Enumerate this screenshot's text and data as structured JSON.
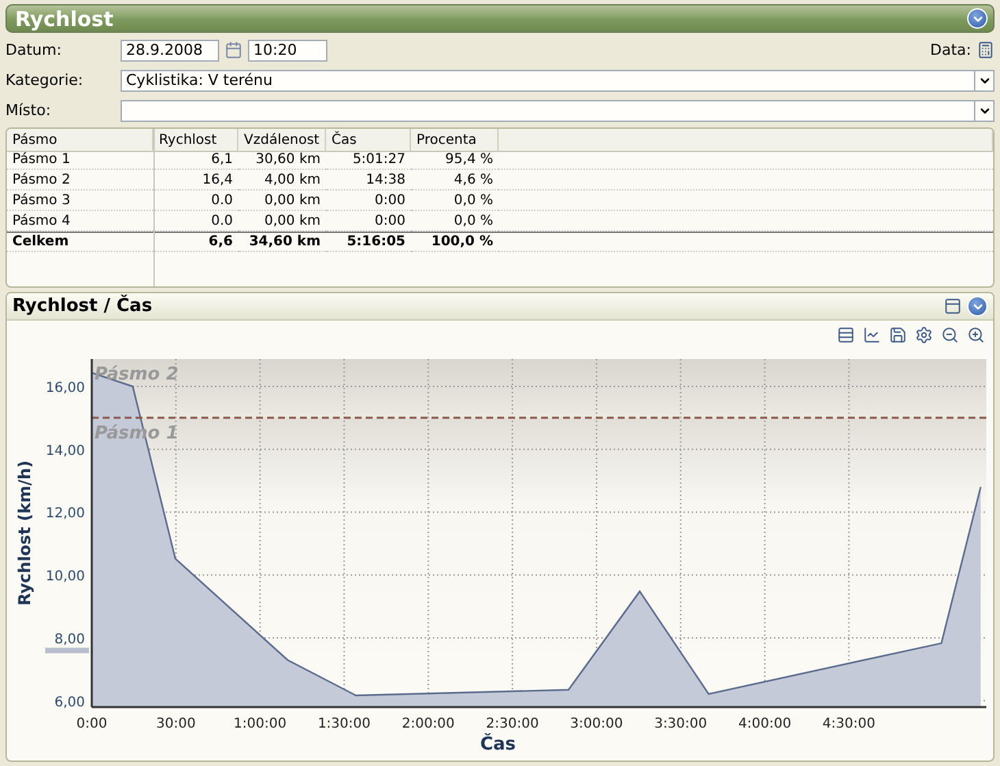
{
  "title": "Rychlost",
  "form": {
    "date_label": "Datum:",
    "date": "28.9.2008",
    "time": "10:20",
    "data_label": "Data:",
    "category_label": "Kategorie:",
    "category": "Cyklistika: V terénu",
    "place_label": "Místo:"
  },
  "table": {
    "columns": [
      "Pásmo",
      "Rychlost",
      "Vzdálenost",
      "Čas",
      "Procenta"
    ],
    "rows": [
      {
        "kind": "row",
        "cells": [
          "Pásmo 1",
          "6,1",
          "30,60 km",
          "5:01:27",
          "95,4 %"
        ]
      },
      {
        "kind": "row",
        "cells": [
          "Pásmo 2",
          "16,4",
          "4,00 km",
          "14:38",
          "4,6 %"
        ]
      },
      {
        "kind": "row",
        "cells": [
          "Pásmo 3",
          "0.0",
          "0,00 km",
          "0:00",
          "0,0 %"
        ]
      },
      {
        "kind": "row",
        "cells": [
          "Pásmo 4",
          "0.0",
          "0,00 km",
          "0:00",
          "0,0 %"
        ]
      },
      {
        "kind": "total",
        "cells": [
          "Celkem",
          "6,6",
          "34,60 km",
          "5:16:05",
          "100,0 %"
        ]
      }
    ]
  },
  "chart_panel": {
    "title": "Rychlost / Čas",
    "chart_data": {
      "type": "area",
      "xlabel": "Čas",
      "ylabel": "Rychlost (km/h)",
      "x": [
        0,
        14.6,
        29.8,
        69.8,
        94.2,
        170,
        195.4,
        220,
        303,
        317
      ],
      "series": [
        {
          "color": "#5a6b8c",
          "values": [
            16.43,
            16.0,
            10.52,
            7.3,
            6.17,
            6.35,
            9.48,
            6.22,
            7.83,
            12.8
          ]
        }
      ],
      "xlim": [
        0,
        319
      ],
      "ylim": [
        5.8,
        16.87
      ],
      "xticks": [
        {
          "value": 0,
          "label": "0:00"
        },
        {
          "value": 30,
          "label": "30:00"
        },
        {
          "value": 60,
          "label": "1:00:00"
        },
        {
          "value": 90,
          "label": "1:30:00"
        },
        {
          "value": 120,
          "label": "2:00:00"
        },
        {
          "value": 150,
          "label": "2:30:00"
        },
        {
          "value": 180,
          "label": "3:00:00"
        },
        {
          "value": 210,
          "label": "3:30:00"
        },
        {
          "value": 240,
          "label": "4:00:00"
        },
        {
          "value": 270,
          "label": "4:30:00"
        }
      ],
      "yticks": [
        {
          "value": 6,
          "label": "6,00"
        },
        {
          "value": 8,
          "label": "8,00"
        },
        {
          "value": 10,
          "label": "10,00"
        },
        {
          "value": 12,
          "label": "12,00"
        },
        {
          "value": 14,
          "label": "14,00"
        },
        {
          "value": 16,
          "label": "16,00"
        }
      ],
      "grid": true,
      "bands": [
        {
          "axis": "y",
          "from": 15,
          "to": 16.87,
          "label": "Pásmo 2"
        },
        {
          "axis": "y",
          "from": 5.8,
          "to": 15,
          "label": "Pásmo 1"
        }
      ],
      "ref_lines": [
        {
          "axis": "y",
          "value": 15
        }
      ]
    }
  }
}
